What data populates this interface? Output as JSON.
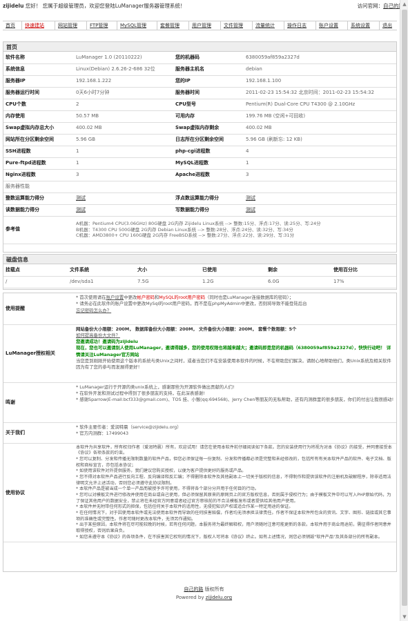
{
  "top": {
    "brand": "zijidelu",
    "greeting": "您好！ 您属于超级管理员，欢迎您登陆LuManager服务器管理系统！",
    "visit_prefix": "访问官网：",
    "visit_link": "自己的路"
  },
  "nav": [
    {
      "label": "首页"
    },
    {
      "label": "快速建站",
      "active": true
    },
    {
      "label": "网站管理"
    },
    {
      "label": "FTP管理"
    },
    {
      "label": "MySQL管理"
    },
    {
      "label": "套餐管理"
    },
    {
      "label": "用户管理"
    },
    {
      "label": "文件管理"
    },
    {
      "label": "流量统计"
    },
    {
      "label": "操作日志"
    },
    {
      "label": "账户设置"
    },
    {
      "label": "系统设置"
    },
    {
      "label": "退出"
    }
  ],
  "home": {
    "title": "首页",
    "rows": [
      [
        "软件名称",
        "LuManager 1.0 (20110222)",
        "您的机器码",
        "6380059af859a2327d"
      ],
      [
        "系统信息",
        "Linux(Debian)   2.6.26-2-686  32位",
        "服务器主机名",
        "debian"
      ],
      [
        "服务器IP",
        "192.168.1.222",
        "您的IP",
        "192.168.1.100"
      ],
      [
        "服务器运行时间",
        "0天6小时7分钟",
        "服务器时间",
        "2011-02-23 15:54:32  北京时间：2011-02-23 15:54:32"
      ],
      [
        "CPU个数",
        "2",
        "CPU型号",
        "Pentium(R) Dual-Core CPU T4300 @ 2.10GHz"
      ],
      [
        "内存使用",
        "50.57 MB",
        "可用内存",
        "199.76 MB (空闲+可回收)"
      ],
      [
        "Swap虚拟内存总大小",
        "400.02 MB",
        "Swap虚拟内存剩余",
        "400.02 MB"
      ],
      [
        "网站所在分区剩余空间",
        "5.96 GB",
        "日志所在分区剩余空间",
        "5.96 GB  (刷新忘: 12 KB)"
      ],
      [
        "SSH进程数",
        "1",
        "php-cgi进程数",
        "4"
      ],
      [
        "Pure-ftpd进程数",
        "1",
        "MySQL进程数",
        "1"
      ],
      [
        "Nginx进程数",
        "3",
        "Apache进程数",
        "3"
      ]
    ],
    "perf_label": "服务器性能",
    "perf_rows": [
      [
        "整数运算能力得分",
        "测试",
        "浮点数运算能力得分",
        "测试"
      ],
      [
        "读数据能力得分",
        "测试",
        "写数据能力得分",
        "测试"
      ]
    ],
    "ref_label": "参考值",
    "ref_lines": [
      "A机器：Pentium4 CPU(3.06GHz)  80G硬盘  2G内存  Zijidelu Linux系统 --> 整数:15分、浮点:17分、读:25分、写:24分",
      "B机器：T4300 CPU  500G硬盘  2G内存  Debian Linux系统 --> 整数:28分、浮点:24分、读:32分、写:34分",
      "C机器：AMD3800+ CPU  160G硬盘  2G内存  FreeBSD系统 --> 整数:27分、浮点:22分、读:29分、写:31分"
    ]
  },
  "disk": {
    "title": "磁盘信息",
    "headers": [
      "挂载点",
      "文件系统",
      "大小",
      "已使用",
      "剩余",
      "使用百分比"
    ],
    "rows": [
      [
        "/",
        "/dev/sda1",
        "7.5G",
        "1.2G",
        "6.0G",
        "17%"
      ]
    ]
  },
  "info": {
    "usage_label": "使用提醒",
    "usage_lines": [
      "* 首次使用请在账户设置中更改帐户密码和MySQL的root用户密码（同时也是LuManager连接数据库的密码）；",
      "* 请务必在此软件的账户设置中更改MySql的root用户密码，而不是在phpMyAdmin中更改，否则将导致不能登陆后台",
      "忘记密码怎么办？"
    ],
    "license_label": "LuManager授权相关",
    "license_lines": [
      "网站备份大小限额：200M，  数据库备份大小限额：200M，  文件备份大小限额：200M，  套餐个数限额：5个",
      "如何提高备份大文件？",
      "您邀请成功！邀请码为zijidelu",
      "现在，您也可以邀请别人使用LuManager，邀请得越多，您的使用权限也将越来越大；邀请码即是您的机器码（6380059af859a2327d），快快行动吧！ 详情请关注LuManager官方网站",
      "当您是到刚刚开始使用这个版本的系统与类Unix之间时，或者当您们不在安装使用本软件的时候，不在帮助您们解决，请耐心地帮助他们，类Unix系统及相关软件因为有了您的参与而发展得更好！"
    ],
    "thanks_label": "鸣谢",
    "thanks_lines": [
      "* LuManager运行于开源的类unix系统上，感谢那些为开源软件做出贡献的人们!",
      "* 在软件开发和测试过程中得到了很多朋友的支持，在此深表感谢!",
      "* 感谢Sparrow(E-mail:bcf333@gmail.com)、TOS 挂、小猴(qq:694568)、Jerry Chen等朋友的无私帮助，还有内测群里的很多朋友，你们的付出让我很感动!"
    ],
    "about_label": "关于我们",
    "about_lines": [
      "* 软件主要作者：爱润特晨（service@zijidelu.org）",
      "* 官方内测群：17499043"
    ],
    "agreement_label": "使用协议",
    "agreement_lines": [
      "本软件为共享软件，所有权归作者（爱润特晨）所有，欢迎试用！请您在使用本软件前仔细阅读如下条款。您的安装使用行为将视为对本《协议》的接受，并同意接受本《协议》各项条款的约束。",
      "* 您可以复制、分发和传播无限制数量的软件产品，但您必须保证每一份复制、分发和传播都必须是完整和未经修改的，包括所有有关本软件产品的软件、电子文档、版权和商标宣言，亦包括本协议；",
      "* 如使用该软件对外提供服务，我们建议您购买授权，以便为客户提供更好的服务或产品。",
      "* 您不得对本软件产品进行反向工程、反向编译和反汇编；不得删除本软件及其他副本上一切关于版权的信息，不得制作和提供该软件的注册机及破解程序，除非适用法律明文允许上述活动，否则您必须遵守此协议限制。",
      "* 本软件产品是被当成一个单一产品而被授予许可使用，不得将各个部分分开用于任何目的行动。",
      "* 您可以对模板文件进行修改并使用在商业或自己使用，但必须保留其原来的原网页上的官方版权信息，否则属于侵权行为；由于模板文件中可以写入PHP原始代码，为了保证其他用户的数据安全，禁止将在未经官方同意或者经过官方审核前的不合法模板发布或者提供给其他用户使用。",
      "* 本软件并无附带任何形式的担保，包括任何关于本软件的适用性，无侵犯知识产权或适合作某一特定用途的保证。",
      "* 在任何情况下，对于因使用本软件或无法使用本软件而导致的任何损害赔偿，作者均无须承担法律责任。作者不保证本软件所包含的资讯、文字、图形、链接或其它事项的准确性或完整性。作者可随时更改本软件，无须另作通知。",
      "* 出于某些原因，本软件将在尽可能较晚的时候，若有任何问题，本服务将为最终解释权，用户须随时注意可能更新的条款。本软件用于商业用途前，需征得作者同意并取得授权，否则后果自负。",
      "* 如您未遵守本《协议》的各项条件，在不损害其它权利的情况下，版权人可将本《协议》终止。如有上述情况，则您必须销毁\"软件产品\"及其各部分的所有副本。"
    ]
  },
  "footer": {
    "line1_link": "自己的路",
    "line1_text": "  版权所有",
    "line2_prefix": "Powered by ",
    "line2_link": "zijidelu.org"
  }
}
